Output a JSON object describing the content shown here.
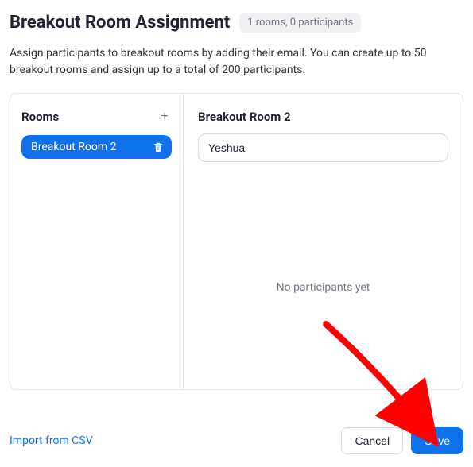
{
  "header": {
    "title": "Breakout Room Assignment",
    "summary": "1 rooms, 0 participants"
  },
  "description": "Assign participants to breakout rooms by adding their email. You can create up to 50 breakout rooms and assign up to a total of 200 participants.",
  "rooms": {
    "title": "Rooms",
    "items": [
      {
        "label": "Breakout Room 2"
      }
    ]
  },
  "detail": {
    "title": "Breakout Room 2",
    "input_value": "Yeshua",
    "empty_text": "No participants yet"
  },
  "footer": {
    "import_label": "Import from CSV",
    "cancel_label": "Cancel",
    "save_label": "Save"
  }
}
